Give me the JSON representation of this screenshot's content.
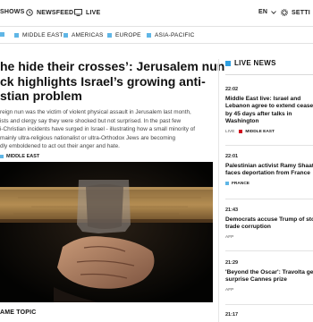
{
  "topbar": {
    "shows_label": "SHOWS",
    "newsfeed_label": "NEWSFEED",
    "live_label": "LIVE",
    "language": "EN",
    "settings_label": "SETTI"
  },
  "subnav": {
    "items": [
      {
        "label": "MIDDLE EAST"
      },
      {
        "label": "AMERICAS"
      },
      {
        "label": "EUROPE"
      },
      {
        "label": "ASIA-PACIFIC"
      }
    ]
  },
  "article": {
    "headline": "he hide their crosses’: Jerusalem nun\nck highlights Israel’s growing anti-\nstian problem",
    "summary": "reign nun was the victim of violent physical assault in Jerusalem last month,\nists and clergy say they were shocked but not surprised. In the past few\ni-Christian incidents have surged in Israel - illustrating how a small minority of\nmainly ultra-religious nationalist or ultra-Orthodox Jews are becoming\ndly emboldened to act out their anger and hate.",
    "tag": "MIDDLE EAST",
    "same_topic_label": "AME TOPIC"
  },
  "live_news": {
    "heading": "LIVE NEWS",
    "items": [
      {
        "time": "22:02",
        "title": "Middle East live: Israel and\nLebanon agree to extend cease\nby 45 days after talks in\nWashington",
        "live_badge": "LIVE",
        "tag": "MIDDLE EAST"
      },
      {
        "time": "22:01",
        "title": "Palestinian activist Ramy Shaat\nfaces deportation from France",
        "tag": "FRANCE"
      },
      {
        "time": "21:43",
        "title": "Democrats accuse Trump of sto\ntrade corruption",
        "source": "AFP"
      },
      {
        "time": "21:29",
        "title": "'Beyond the Oscar': Travolta ge\nsurprise Cannes prize",
        "source": "AFP"
      },
      {
        "time": "21:17"
      }
    ]
  },
  "colors": {
    "accent_blue": "#5fb6e6",
    "live_red": "#d0021b"
  }
}
